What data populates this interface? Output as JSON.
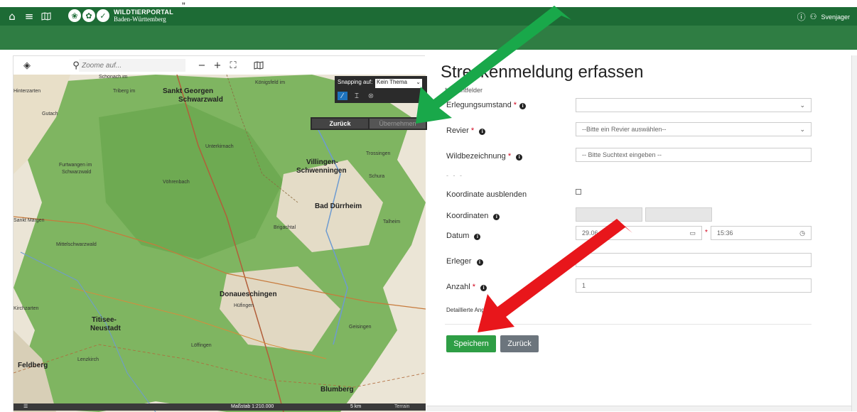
{
  "top_text": "„",
  "header": {
    "brand_line1": "WILDTIERPORTAL",
    "brand_line2": "Baden-Württemberg",
    "username": "Svenjager"
  },
  "map": {
    "search_placeholder": "Zoome auf...",
    "snapping_label": "Snapping auf:",
    "snapping_value": "Kein Thema",
    "back_button": "Zurück",
    "apply_button": "Übernehmen",
    "scale_text": "Maßstab 1:210.000",
    "scale_bar": "5 km",
    "scale_bar_extra": "Terrain",
    "labels": {
      "sankt_georgen": "Sankt Georgen",
      "schwarzwald": "Schwarzwald",
      "villingen": "Villingen-",
      "schwenningen": "Schwenningen",
      "trossingen": "Trossingen",
      "bad_duerrheim": "Bad Dürrheim",
      "donaueschingen": "Donaueschingen",
      "titisee": "Titisee-",
      "neustadt": "Neustadt",
      "feldberg": "Feldberg",
      "lenzkirch": "Lenzkirch",
      "bloemberg": "Blumberg",
      "furtwangen": "Furtwangen im",
      "schwarzwald2": "Schwarzwald",
      "sankt_margen": "Sankt Märgen",
      "loeffingen": "Löffingen",
      "hinterzarten": "Hinterzarten",
      "kirchzarten": "Kirchzarten",
      "koenigsfeld": "Königsfeld im",
      "schonach": "Schonach im",
      "triberg": "Triberg im",
      "gutach": "Gutach",
      "brigachtal": "Brigachtal",
      "hufingen": "Hüfingen",
      "geisingen": "Geisingen",
      "talheim": "Talheim",
      "schura": "Schura",
      "unterkirnach": "Unterkirnach",
      "voehrenbach": "Vöhrenbach",
      "boehrenbach2": "Mittelschwarzwald"
    }
  },
  "form": {
    "title": "Streckenmeldung erfassen",
    "required_note": "* Pflichtfelder",
    "labels": {
      "erlegungsumstand": "Erlegungsumstand",
      "revier": "Revier",
      "wildbezeichnung": "Wildbezeichnung",
      "koordinate_ausblenden": "Koordinate ausblenden",
      "koordinaten": "Koordinaten",
      "datum": "Datum",
      "erleger": "Erleger",
      "anzahl": "Anzahl",
      "detailliert": "Detaillierte Angaben"
    },
    "separator": "- - -",
    "revier_placeholder": "--Bitte ein Revier auswählen--",
    "wild_placeholder": "-- Bitte Suchtext eingeben --",
    "date_value": "29.06.2022",
    "time_value": "15:36",
    "anzahl_value": "1",
    "save_button": "Speichern",
    "back_button": "Zurück"
  },
  "colors": {
    "header_green": "#1d6b35",
    "subbar_green": "#2f7d43",
    "save_green": "#2e9e45",
    "back_gray": "#6c757d",
    "required_red": "#d0021b",
    "arrow_green": "#19a84a",
    "arrow_red": "#e8161b"
  }
}
